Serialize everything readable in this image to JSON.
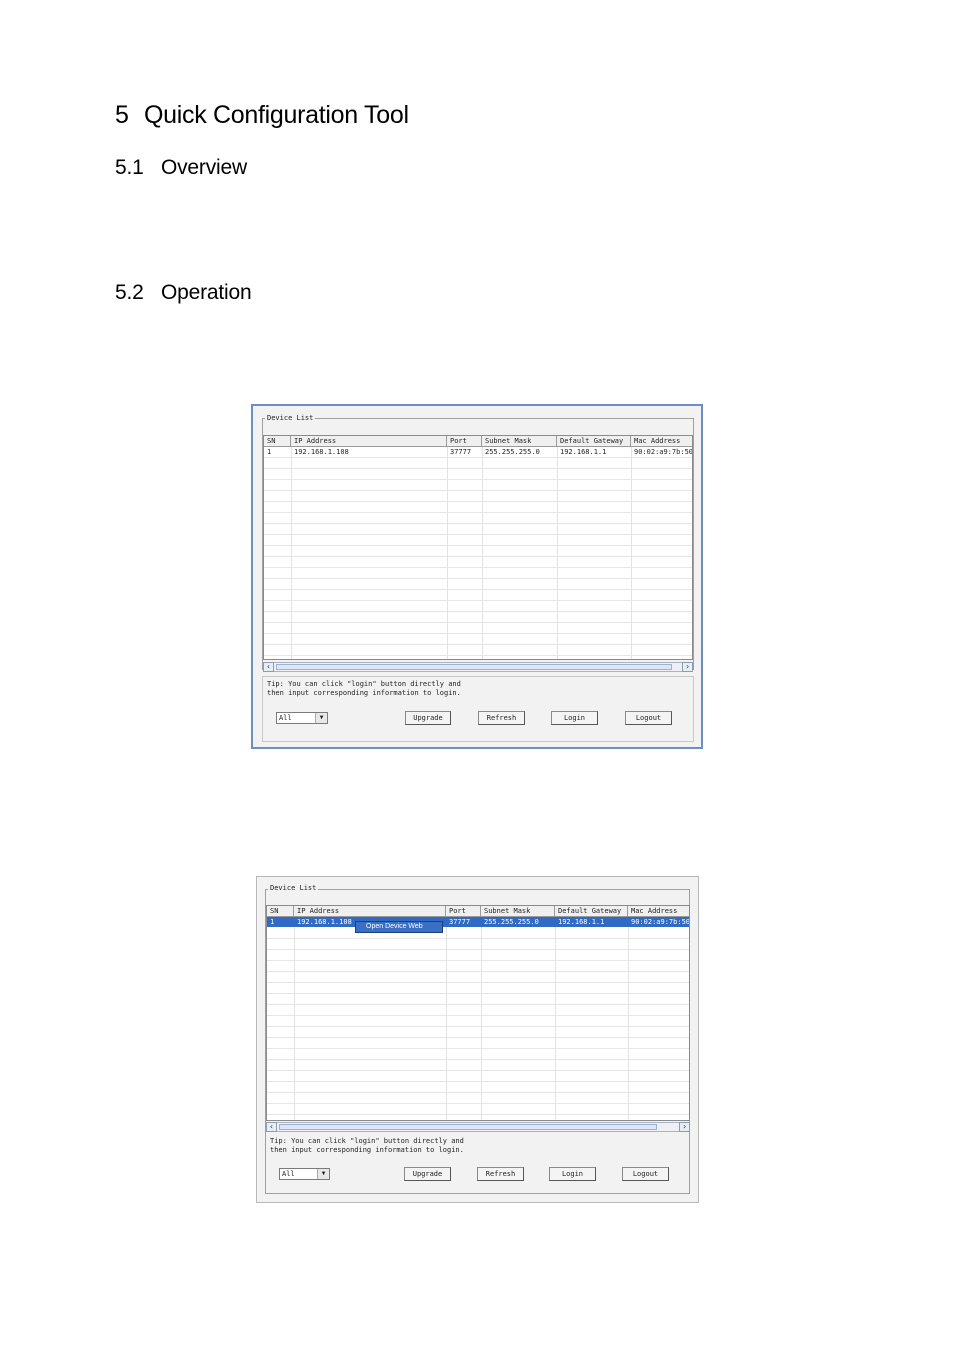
{
  "doc": {
    "title_num": "5",
    "title": "Quick Configuration Tool",
    "sec1_num": "5.1",
    "sec1": "Overview",
    "sec2_num": "5.2",
    "sec2": "Operation"
  },
  "screens": [
    {
      "group_label": "Device List",
      "columns": [
        "SN",
        "IP Address",
        "Port",
        "Subnet Mask",
        "Default Gateway",
        "Mac Address"
      ],
      "rows": [
        [
          "1",
          "192.168.1.108",
          "37777",
          "255.255.255.0",
          "192.168.1.1",
          "90:02:a9:7b:50"
        ]
      ],
      "tip_line1": "Tip: You can click \"login\" button directly and",
      "tip_line2": "then input corresponding information to login.",
      "filter_value": "All",
      "buttons": {
        "upgrade": "Upgrade",
        "refresh": "Refresh",
        "login": "Login",
        "logout": "Logout"
      }
    },
    {
      "group_label": "Device List",
      "columns": [
        "SN",
        "IP Address",
        "Port",
        "Subnet Mask",
        "Default Gateway",
        "Mac Address"
      ],
      "rows": [
        [
          "1",
          "192.168.1.108",
          "37777",
          "255.255.255.0",
          "192.168.1.1",
          "90:02:a9:7b:50"
        ]
      ],
      "context_menu_item": "Open Device Web",
      "tip_line1": "Tip: You can click \"login\" button directly and",
      "tip_line2": "then input corresponding information to login.",
      "filter_value": "All",
      "buttons": {
        "upgrade": "Upgrade",
        "refresh": "Refresh",
        "login": "Login",
        "logout": "Logout"
      }
    }
  ]
}
